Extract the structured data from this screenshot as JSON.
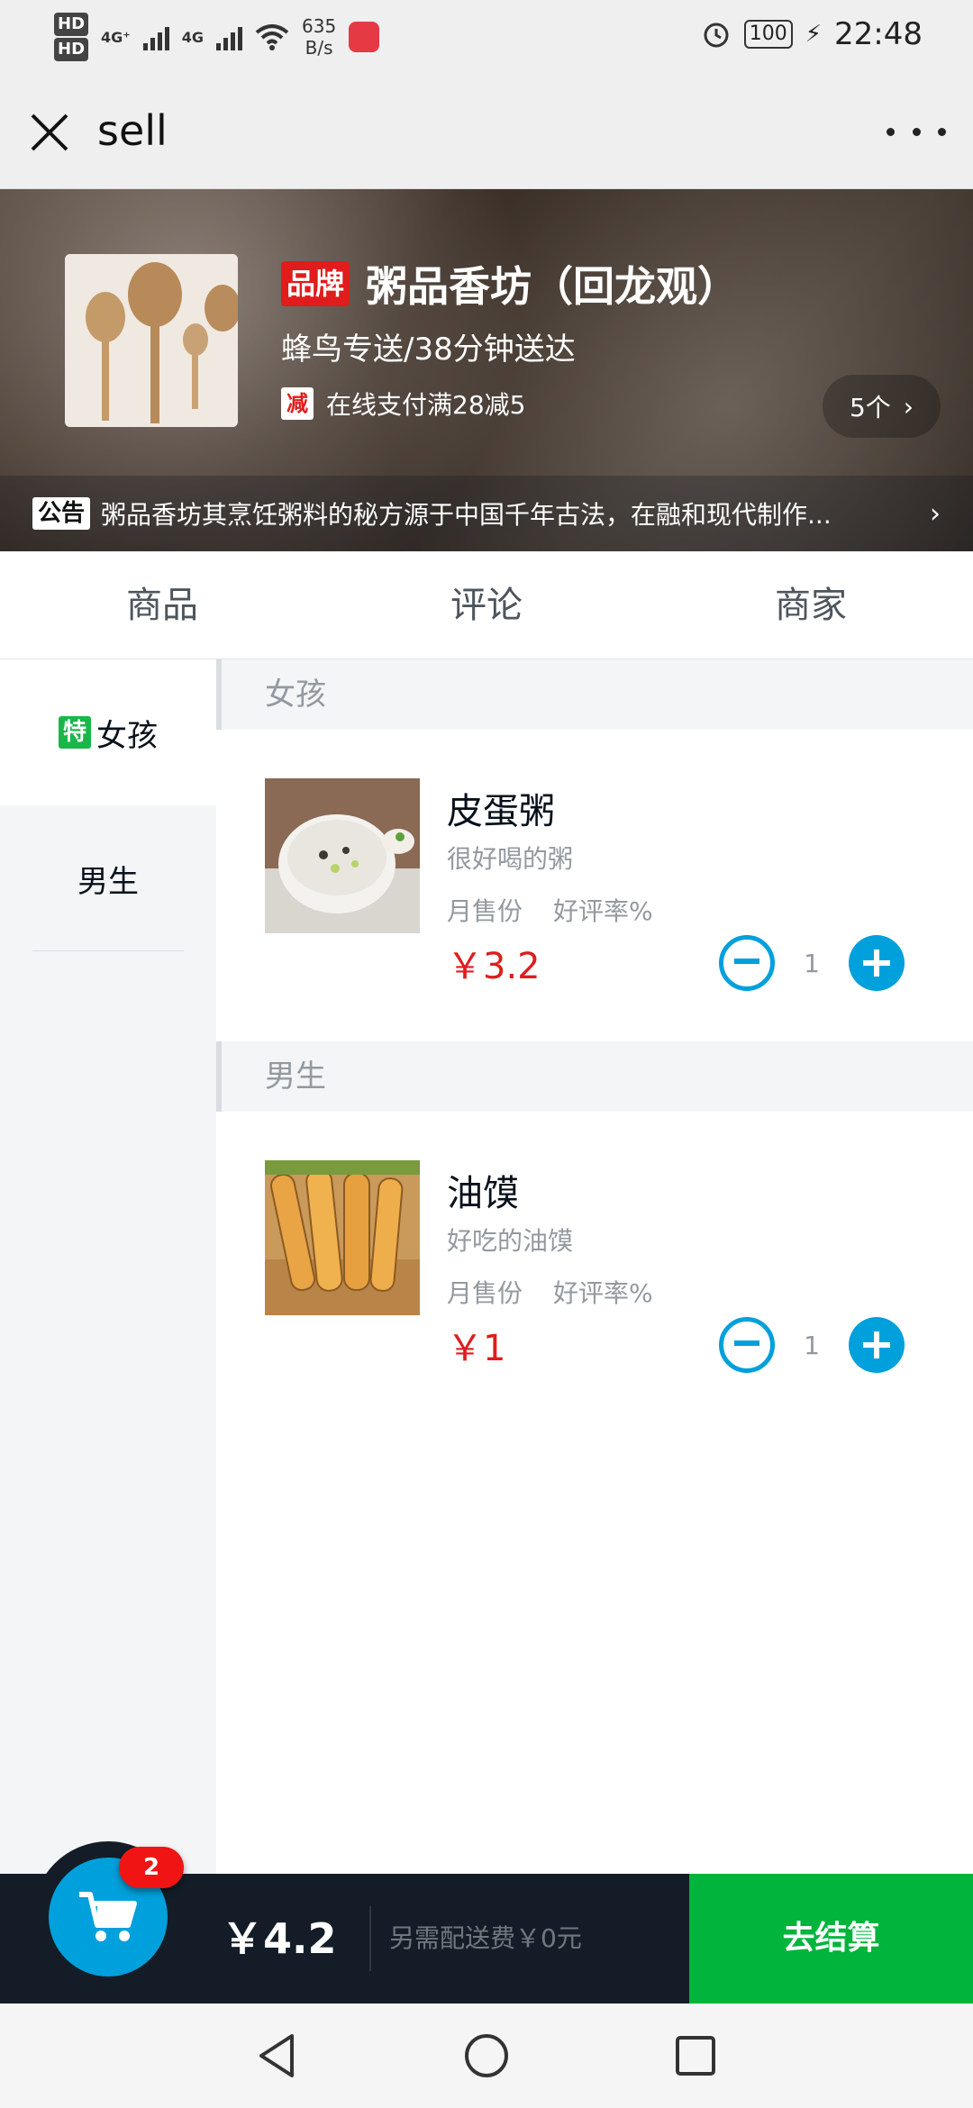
{
  "status_bar": {
    "net_1": "4G⁺",
    "net_2": "4G",
    "speed_value": "635",
    "speed_unit": "B/s",
    "battery": "100",
    "time": "22:48"
  },
  "header": {
    "title": "sell"
  },
  "seller": {
    "brand_label": "品牌",
    "name": "粥品香坊（回龙观）",
    "delivery": "蜂鸟专送/38分钟送达",
    "support_type_label": "减",
    "support_text": "在线支付满28减5",
    "support_count": "5个",
    "bulletin_label": "公告",
    "bulletin": "粥品香坊其烹饪粥料的秘方源于中国千年古法，在融和现代制作..."
  },
  "tabs": [
    {
      "label": "商品"
    },
    {
      "label": "评论"
    },
    {
      "label": "商家"
    }
  ],
  "menu": [
    {
      "badge": "特",
      "label": "女孩"
    },
    {
      "label": "男生"
    }
  ],
  "groups": [
    {
      "title": "女孩",
      "food": {
        "name": "皮蛋粥",
        "desc": "很好喝的粥",
        "sell": "月售份",
        "rating": "好评率%",
        "price": "￥3.2",
        "count": "1"
      }
    },
    {
      "title": "男生",
      "food": {
        "name": "油馍",
        "desc": "好吃的油馍",
        "sell": "月售份",
        "rating": "好评率%",
        "price": "￥1",
        "count": "1"
      }
    }
  ],
  "shopcart": {
    "count": "2",
    "total": "￥4.2",
    "delivery_fee": "另需配送费￥0元",
    "pay_label": "去结算"
  },
  "colors": {
    "accent": "#00a0dc",
    "price": "#e01c1c",
    "pay": "#00b43c",
    "cart_bar": "#141d27"
  },
  "icons": [
    "close-icon",
    "more-icon",
    "cart-icon",
    "chevron-right-icon",
    "back-icon",
    "home-icon",
    "recents-icon"
  ]
}
